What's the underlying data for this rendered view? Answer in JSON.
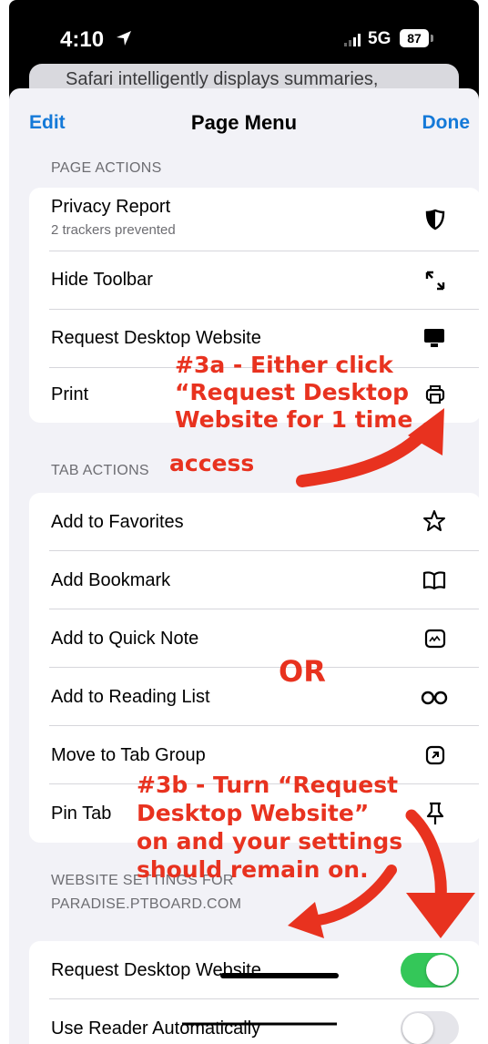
{
  "status_bar": {
    "time": "4:10",
    "network": "5G",
    "battery": "87"
  },
  "behind_text": "Safari intelligently displays summaries,",
  "nav": {
    "edit": "Edit",
    "title": "Page Menu",
    "done": "Done"
  },
  "page_actions": {
    "header": "PAGE ACTIONS",
    "items": [
      {
        "label": "Privacy Report",
        "sublabel": "2 trackers prevented",
        "icon": "privacy-shield-icon"
      },
      {
        "label": "Hide Toolbar",
        "icon": "resize-arrows-icon"
      },
      {
        "label": "Request Desktop Website",
        "icon": "desktop-monitor-icon"
      },
      {
        "label": "Print",
        "icon": "printer-icon"
      }
    ]
  },
  "tab_actions": {
    "header": "TAB ACTIONS",
    "items": [
      {
        "label": "Add to Favorites",
        "icon": "star-icon"
      },
      {
        "label": "Add Bookmark",
        "icon": "book-icon"
      },
      {
        "label": "Add to Quick Note",
        "icon": "quick-note-icon"
      },
      {
        "label": "Add to Reading List",
        "icon": "glasses-icon"
      },
      {
        "label": "Move to Tab Group",
        "icon": "tab-group-icon"
      },
      {
        "label": "Pin Tab",
        "icon": "pin-icon"
      }
    ]
  },
  "website_settings": {
    "header_line1": "WEBSITE SETTINGS FOR",
    "header_line2": "PARADISE.PTBOARD.COM",
    "items": [
      {
        "label": "Request Desktop Website",
        "toggle_on": true
      },
      {
        "label": "Use Reader Automatically",
        "toggle_on": false
      }
    ]
  },
  "annotations": {
    "a3": [
      "#3a - Either click",
      "“Request Desktop",
      "Website for 1 time",
      "access"
    ],
    "or": "OR",
    "b3": [
      "#3b - Turn “Request",
      "Desktop Website”",
      "on and your settings",
      "should remain on."
    ],
    "color": "#e8321f"
  },
  "colors": {
    "accent": "#1479d8",
    "toggle_on": "#34c759",
    "sheet_bg": "#f2f2f7"
  }
}
